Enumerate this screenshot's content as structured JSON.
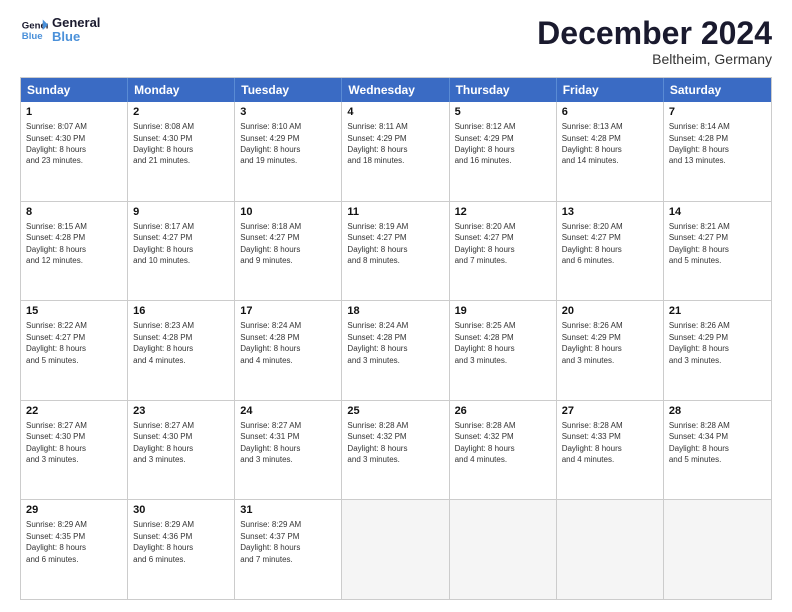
{
  "logo": {
    "line1": "General",
    "line2": "Blue"
  },
  "title": "December 2024",
  "subtitle": "Beltheim, Germany",
  "days": [
    "Sunday",
    "Monday",
    "Tuesday",
    "Wednesday",
    "Thursday",
    "Friday",
    "Saturday"
  ],
  "rows": [
    [
      {
        "day": "1",
        "text": "Sunrise: 8:07 AM\nSunset: 4:30 PM\nDaylight: 8 hours\nand 23 minutes."
      },
      {
        "day": "2",
        "text": "Sunrise: 8:08 AM\nSunset: 4:30 PM\nDaylight: 8 hours\nand 21 minutes."
      },
      {
        "day": "3",
        "text": "Sunrise: 8:10 AM\nSunset: 4:29 PM\nDaylight: 8 hours\nand 19 minutes."
      },
      {
        "day": "4",
        "text": "Sunrise: 8:11 AM\nSunset: 4:29 PM\nDaylight: 8 hours\nand 18 minutes."
      },
      {
        "day": "5",
        "text": "Sunrise: 8:12 AM\nSunset: 4:29 PM\nDaylight: 8 hours\nand 16 minutes."
      },
      {
        "day": "6",
        "text": "Sunrise: 8:13 AM\nSunset: 4:28 PM\nDaylight: 8 hours\nand 14 minutes."
      },
      {
        "day": "7",
        "text": "Sunrise: 8:14 AM\nSunset: 4:28 PM\nDaylight: 8 hours\nand 13 minutes."
      }
    ],
    [
      {
        "day": "8",
        "text": "Sunrise: 8:15 AM\nSunset: 4:28 PM\nDaylight: 8 hours\nand 12 minutes."
      },
      {
        "day": "9",
        "text": "Sunrise: 8:17 AM\nSunset: 4:27 PM\nDaylight: 8 hours\nand 10 minutes."
      },
      {
        "day": "10",
        "text": "Sunrise: 8:18 AM\nSunset: 4:27 PM\nDaylight: 8 hours\nand 9 minutes."
      },
      {
        "day": "11",
        "text": "Sunrise: 8:19 AM\nSunset: 4:27 PM\nDaylight: 8 hours\nand 8 minutes."
      },
      {
        "day": "12",
        "text": "Sunrise: 8:20 AM\nSunset: 4:27 PM\nDaylight: 8 hours\nand 7 minutes."
      },
      {
        "day": "13",
        "text": "Sunrise: 8:20 AM\nSunset: 4:27 PM\nDaylight: 8 hours\nand 6 minutes."
      },
      {
        "day": "14",
        "text": "Sunrise: 8:21 AM\nSunset: 4:27 PM\nDaylight: 8 hours\nand 5 minutes."
      }
    ],
    [
      {
        "day": "15",
        "text": "Sunrise: 8:22 AM\nSunset: 4:27 PM\nDaylight: 8 hours\nand 5 minutes."
      },
      {
        "day": "16",
        "text": "Sunrise: 8:23 AM\nSunset: 4:28 PM\nDaylight: 8 hours\nand 4 minutes."
      },
      {
        "day": "17",
        "text": "Sunrise: 8:24 AM\nSunset: 4:28 PM\nDaylight: 8 hours\nand 4 minutes."
      },
      {
        "day": "18",
        "text": "Sunrise: 8:24 AM\nSunset: 4:28 PM\nDaylight: 8 hours\nand 3 minutes."
      },
      {
        "day": "19",
        "text": "Sunrise: 8:25 AM\nSunset: 4:28 PM\nDaylight: 8 hours\nand 3 minutes."
      },
      {
        "day": "20",
        "text": "Sunrise: 8:26 AM\nSunset: 4:29 PM\nDaylight: 8 hours\nand 3 minutes."
      },
      {
        "day": "21",
        "text": "Sunrise: 8:26 AM\nSunset: 4:29 PM\nDaylight: 8 hours\nand 3 minutes."
      }
    ],
    [
      {
        "day": "22",
        "text": "Sunrise: 8:27 AM\nSunset: 4:30 PM\nDaylight: 8 hours\nand 3 minutes."
      },
      {
        "day": "23",
        "text": "Sunrise: 8:27 AM\nSunset: 4:30 PM\nDaylight: 8 hours\nand 3 minutes."
      },
      {
        "day": "24",
        "text": "Sunrise: 8:27 AM\nSunset: 4:31 PM\nDaylight: 8 hours\nand 3 minutes."
      },
      {
        "day": "25",
        "text": "Sunrise: 8:28 AM\nSunset: 4:32 PM\nDaylight: 8 hours\nand 3 minutes."
      },
      {
        "day": "26",
        "text": "Sunrise: 8:28 AM\nSunset: 4:32 PM\nDaylight: 8 hours\nand 4 minutes."
      },
      {
        "day": "27",
        "text": "Sunrise: 8:28 AM\nSunset: 4:33 PM\nDaylight: 8 hours\nand 4 minutes."
      },
      {
        "day": "28",
        "text": "Sunrise: 8:28 AM\nSunset: 4:34 PM\nDaylight: 8 hours\nand 5 minutes."
      }
    ],
    [
      {
        "day": "29",
        "text": "Sunrise: 8:29 AM\nSunset: 4:35 PM\nDaylight: 8 hours\nand 6 minutes."
      },
      {
        "day": "30",
        "text": "Sunrise: 8:29 AM\nSunset: 4:36 PM\nDaylight: 8 hours\nand 6 minutes."
      },
      {
        "day": "31",
        "text": "Sunrise: 8:29 AM\nSunset: 4:37 PM\nDaylight: 8 hours\nand 7 minutes."
      },
      {
        "day": "",
        "text": ""
      },
      {
        "day": "",
        "text": ""
      },
      {
        "day": "",
        "text": ""
      },
      {
        "day": "",
        "text": ""
      }
    ]
  ]
}
